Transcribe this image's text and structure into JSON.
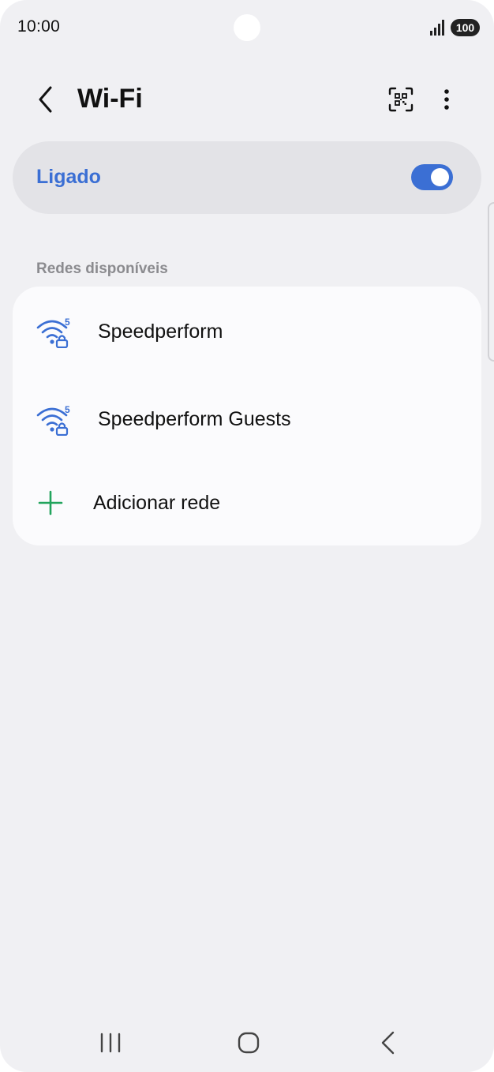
{
  "status_bar": {
    "time": "10:00",
    "battery": "100",
    "icons": [
      "signal-icon",
      "battery-icon"
    ]
  },
  "header": {
    "title": "Wi-Fi",
    "icons": [
      "back-arrow-icon",
      "qr-code-scan-icon",
      "more-options-icon"
    ]
  },
  "master_switch": {
    "label": "Ligado",
    "enabled": true,
    "accent_color": "#3b6fd4"
  },
  "section": {
    "title": "Redes disponíveis"
  },
  "networks": [
    {
      "name": "Speedperform",
      "icon": "wifi-5ghz-secured-icon"
    },
    {
      "name": "Speedperform Guests",
      "icon": "wifi-5ghz-secured-icon"
    }
  ],
  "add_network": {
    "label": "Adicionar rede",
    "icon": "plus-icon",
    "icon_color": "#22a45d"
  },
  "nav_bar": {
    "icons": [
      "recent-apps-icon",
      "home-icon",
      "back-icon"
    ]
  }
}
